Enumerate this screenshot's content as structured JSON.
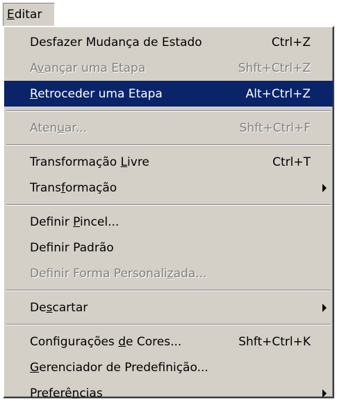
{
  "menubar": {
    "edit_menu": {
      "mnemonic": "E",
      "rest": "ditar"
    }
  },
  "menu": {
    "groups": [
      [
        {
          "id": "undo-state-change",
          "parts": [
            "Desfazer Mudança de Estado"
          ],
          "shortcut": "Ctrl+Z",
          "disabled": false,
          "highlighted": false,
          "submenu": false
        },
        {
          "id": "step-forward",
          "parts": [
            "A",
            "v",
            "ançar uma Etapa"
          ],
          "shortcut": "Shft+Ctrl+Z",
          "disabled": true,
          "highlighted": false,
          "submenu": false
        },
        {
          "id": "step-backward",
          "parts": [
            "",
            "R",
            "etroceder uma Etapa"
          ],
          "shortcut": "Alt+Ctrl+Z",
          "disabled": false,
          "highlighted": true,
          "submenu": false
        }
      ],
      [
        {
          "id": "fade",
          "parts": [
            "Aten",
            "u",
            "ar..."
          ],
          "shortcut": "Shft+Ctrl+F",
          "disabled": true,
          "highlighted": false,
          "submenu": false
        }
      ],
      [
        {
          "id": "free-transform",
          "parts": [
            "Transformação ",
            "L",
            "ivre"
          ],
          "shortcut": "Ctrl+T",
          "disabled": false,
          "highlighted": false,
          "submenu": false
        },
        {
          "id": "transform",
          "parts": [
            "Trans",
            "f",
            "ormação"
          ],
          "shortcut": "",
          "disabled": false,
          "highlighted": false,
          "submenu": true
        }
      ],
      [
        {
          "id": "define-brush",
          "parts": [
            "Definir ",
            "P",
            "incel..."
          ],
          "shortcut": "",
          "disabled": false,
          "highlighted": false,
          "submenu": false
        },
        {
          "id": "define-pattern",
          "parts": [
            "Def",
            "i",
            "nir Padrão"
          ],
          "shortcut": "",
          "disabled": false,
          "highlighted": false,
          "submenu": false
        },
        {
          "id": "define-custom-shape",
          "parts": [
            "Definir Forma Personali",
            "z",
            "ada..."
          ],
          "shortcut": "",
          "disabled": true,
          "highlighted": false,
          "submenu": false
        }
      ],
      [
        {
          "id": "purge",
          "parts": [
            "De",
            "s",
            "cartar"
          ],
          "shortcut": "",
          "disabled": false,
          "highlighted": false,
          "submenu": true
        }
      ],
      [
        {
          "id": "color-settings",
          "parts": [
            "Configurações ",
            "d",
            "e Cores..."
          ],
          "shortcut": "Shft+Ctrl+K",
          "disabled": false,
          "highlighted": false,
          "submenu": false
        },
        {
          "id": "preset-manager",
          "parts": [
            "",
            "G",
            "erenciador de Predefinição..."
          ],
          "shortcut": "",
          "disabled": false,
          "highlighted": false,
          "submenu": false
        },
        {
          "id": "preferences",
          "parts": [
            "Preferê",
            "n",
            "cias"
          ],
          "shortcut": "",
          "disabled": false,
          "highlighted": false,
          "submenu": true
        }
      ]
    ]
  }
}
